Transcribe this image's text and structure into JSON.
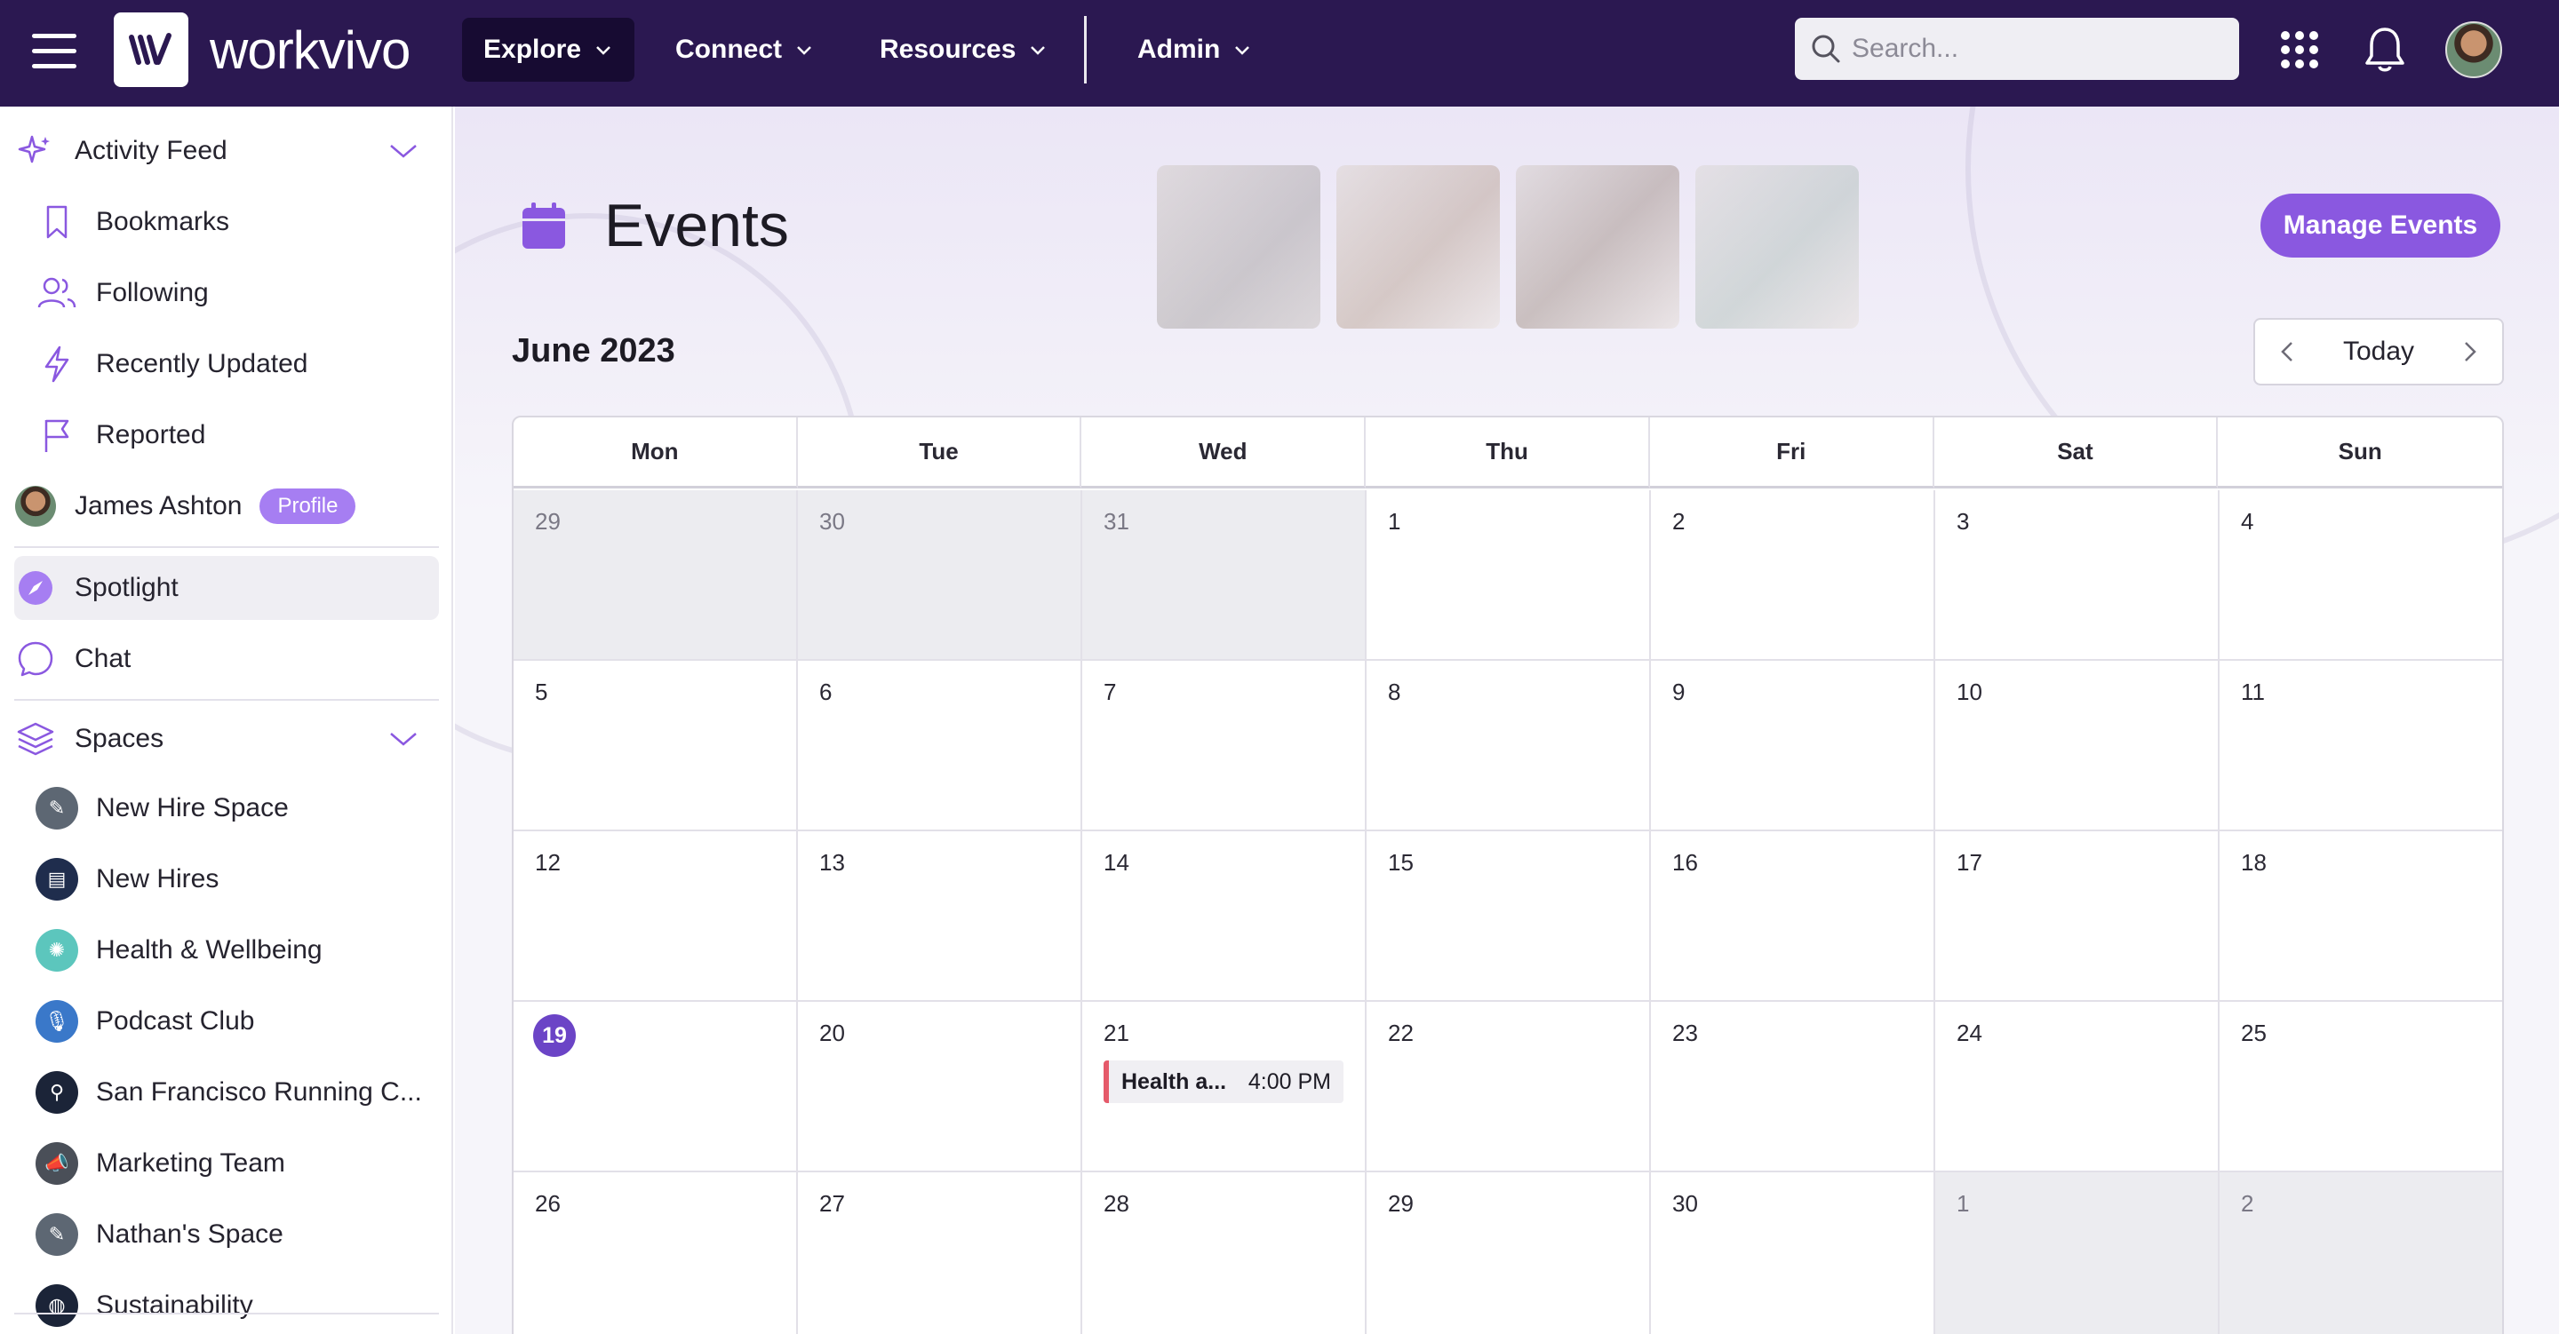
{
  "app": {
    "brand": "workvivo"
  },
  "nav": {
    "items": [
      {
        "label": "Explore"
      },
      {
        "label": "Connect"
      },
      {
        "label": "Resources"
      },
      {
        "label": "Admin"
      }
    ],
    "search_placeholder": "Search..."
  },
  "sidebar": {
    "activity_feed": "Activity Feed",
    "feed_items": [
      "Bookmarks",
      "Following",
      "Recently Updated",
      "Reported"
    ],
    "user_name": "James Ashton",
    "profile_badge": "Profile",
    "spotlight": "Spotlight",
    "chat": "Chat",
    "spaces_label": "Spaces",
    "spaces": [
      "New Hire Space",
      "New Hires",
      "Health & Wellbeing",
      "Podcast Club",
      "San Francisco Running C...",
      "Marketing Team",
      "Nathan's Space",
      "Sustainability"
    ]
  },
  "main": {
    "title": "Events",
    "manage_button": "Manage Events",
    "month": "June 2023",
    "today_button": "Today",
    "weekdays": [
      "Mon",
      "Tue",
      "Wed",
      "Thu",
      "Fri",
      "Sat",
      "Sun"
    ],
    "weeks": [
      [
        "29",
        "30",
        "31",
        "1",
        "2",
        "3",
        "4"
      ],
      [
        "5",
        "6",
        "7",
        "8",
        "9",
        "10",
        "11"
      ],
      [
        "12",
        "13",
        "14",
        "15",
        "16",
        "17",
        "18"
      ],
      [
        "19",
        "20",
        "21",
        "22",
        "23",
        "24",
        "25"
      ],
      [
        "26",
        "27",
        "28",
        "29",
        "30",
        "1",
        "2"
      ]
    ],
    "today": "19",
    "event": {
      "name": "Health a...",
      "time": "4:00 PM"
    }
  },
  "colors": {
    "nav_bg": "#2b1851",
    "accent": "#8a58e0",
    "today_circle": "#6b44c6",
    "event_marker": "#e55a6a"
  }
}
